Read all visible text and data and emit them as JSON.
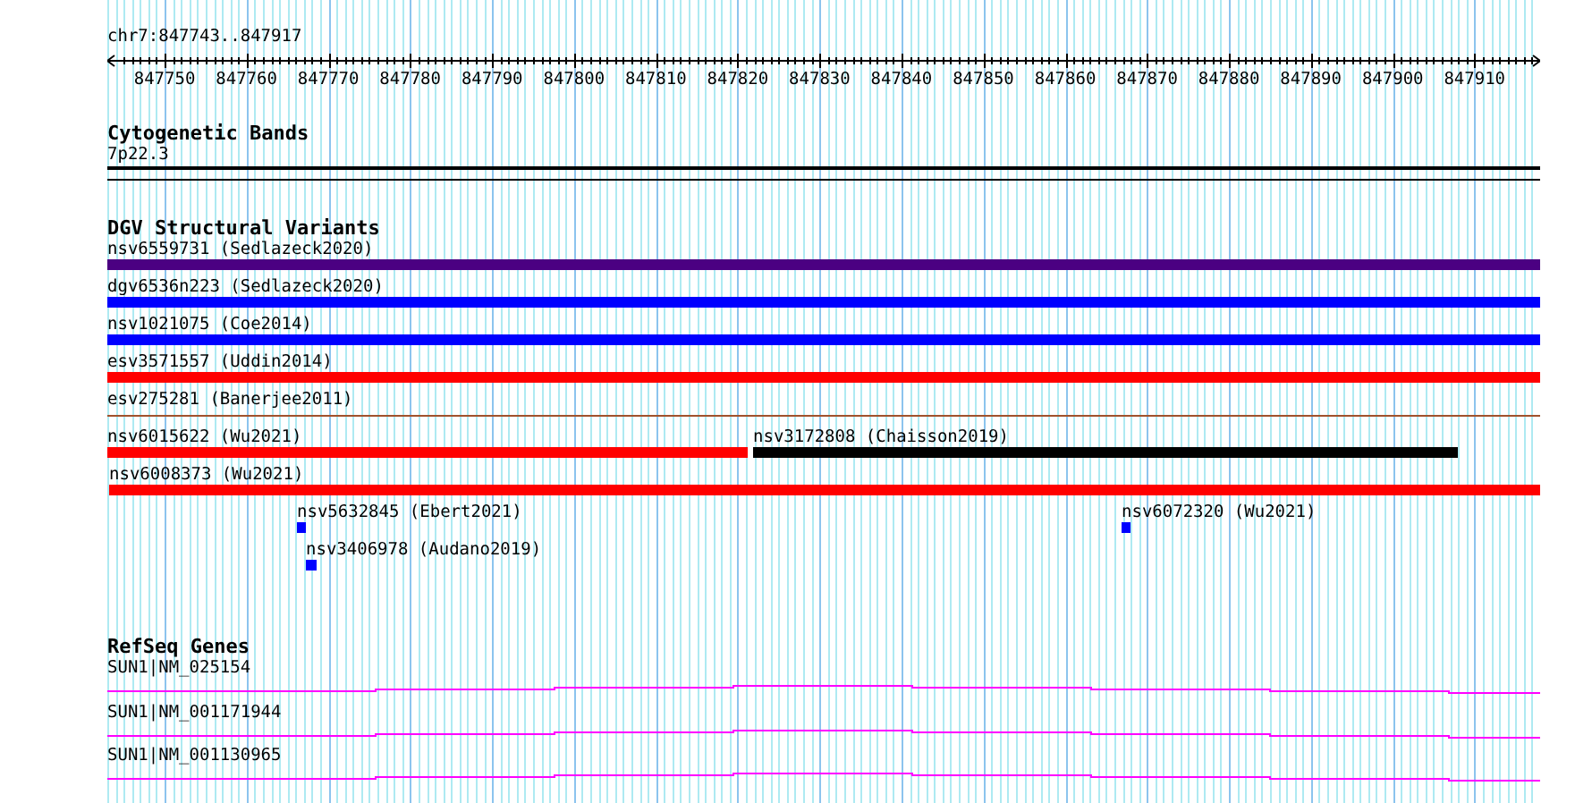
{
  "location": "chr7:847743..847917",
  "ruler": {
    "tick_labels": [
      "847750",
      "847760",
      "847770",
      "847780",
      "847790",
      "847800",
      "847810",
      "847820",
      "847830",
      "847840",
      "847850",
      "847860",
      "847870",
      "847880",
      "847890",
      "847900",
      "847910"
    ]
  },
  "tracks": [
    {
      "kind": "cytoband",
      "title": "Cytogenetic Bands",
      "band": "7p22.3"
    },
    {
      "kind": "variants",
      "title": "DGV Structural Variants",
      "rows": [
        {
          "features": [
            {
              "label": "nsv6559731 (Sedlazeck2020)",
              "color": "#4b0082"
            }
          ]
        },
        {
          "features": [
            {
              "label": "dgv6536n223 (Sedlazeck2020)",
              "color": "#0000ff"
            }
          ]
        },
        {
          "features": [
            {
              "label": "nsv1021075 (Coe2014)",
              "color": "#0000ff"
            }
          ]
        },
        {
          "features": [
            {
              "label": "esv3571557 (Uddin2014)",
              "color": "#ff0000"
            }
          ]
        },
        {
          "features": [
            {
              "label": "esv275281 (Banerjee2011)",
              "color": "#a0522d"
            }
          ]
        },
        {
          "features": [
            {
              "label": "nsv6015622 (Wu2021)",
              "color": "#ff0000"
            },
            {
              "label": "nsv3172808 (Chaisson2019)",
              "color": "#000000"
            }
          ]
        },
        {
          "features": [
            {
              "label": "nsv6008373 (Wu2021)",
              "color": "#ff0000"
            }
          ]
        },
        {
          "features": [
            {
              "label": "nsv5632845 (Ebert2021)",
              "color": "#0000ff"
            },
            {
              "label": "nsv6072320 (Wu2021)",
              "color": "#0000ff"
            }
          ]
        },
        {
          "features": [
            {
              "label": "nsv3406978 (Audano2019)",
              "color": "#0000ff"
            }
          ]
        }
      ]
    },
    {
      "kind": "genes",
      "title": "RefSeq Genes",
      "genes": [
        {
          "label": "SUN1|NM_025154"
        },
        {
          "label": "SUN1|NM_001171944"
        },
        {
          "label": "SUN1|NM_001130965"
        }
      ]
    }
  ]
}
